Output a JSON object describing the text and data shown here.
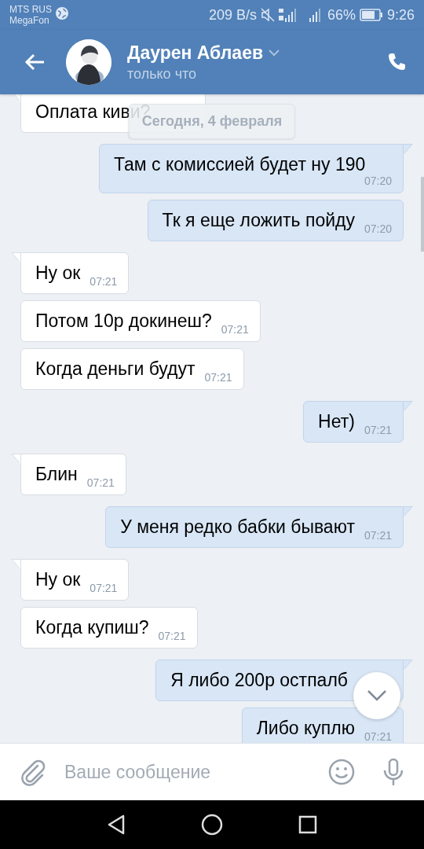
{
  "status_bar": {
    "carrier_1": "MTS RUS",
    "carrier_2": "MegaFon",
    "speed": "209 B/s",
    "battery": "66%",
    "time": "9:26"
  },
  "header": {
    "name": "Даурен Аблаев",
    "status": "только что"
  },
  "date_separator": "Сегодня, 4 февраля",
  "messages": [
    {
      "kind": "incoming",
      "text": "Оплата киви?"
    },
    {
      "kind": "outgoing",
      "text": "Там с комиссией будет ну 190",
      "time": "07:20"
    },
    {
      "kind": "outgoing",
      "text": "Тк я еще ложить пойду",
      "time": "07:20"
    },
    {
      "kind": "incoming",
      "text": "Ну ок",
      "time": "07:21"
    },
    {
      "kind": "incoming",
      "text": "Потом 10р докинеш?",
      "time": "07:21"
    },
    {
      "kind": "incoming",
      "text": "Когда деньги будут",
      "time": "07:21"
    },
    {
      "kind": "outgoing",
      "text": "Нет)",
      "time": "07:21"
    },
    {
      "kind": "incoming",
      "text": "Блин",
      "time": "07:21"
    },
    {
      "kind": "outgoing",
      "text": "У меня редко бабки бывают",
      "time": "07:21"
    },
    {
      "kind": "incoming",
      "text": "Ну ок",
      "time": "07:21"
    },
    {
      "kind": "incoming",
      "text": "Когда купиш?",
      "time": "07:21"
    },
    {
      "kind": "outgoing",
      "text": "Я либо 200р остпалб"
    },
    {
      "kind": "outgoing",
      "text": "Либо куплю",
      "time": "07:21"
    }
  ],
  "composer": {
    "placeholder": "Ваше сообщение"
  }
}
